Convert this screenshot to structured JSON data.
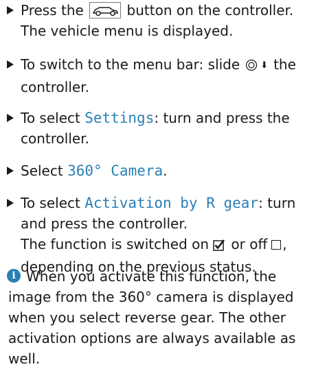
{
  "steps": [
    {
      "a": "Press the",
      "b": "button on the controller.",
      "c": "The vehicle menu is displayed.",
      "icon": "car-button-icon"
    },
    {
      "a": "To switch to the menu bar: slide",
      "b": "the",
      "c": "controller.",
      "icons": [
        "controller-icon",
        "down-arrow-icon"
      ]
    },
    {
      "a": "To select",
      "keyword": "Settings",
      "b": ": turn and press the",
      "c": "controller."
    },
    {
      "a": "Select",
      "keyword": "360° Camera",
      "b": "."
    },
    {
      "a": "To select",
      "keyword": "Activation by R gear",
      "b": ": turn",
      "c": "and press the controller.",
      "d": "The function is switched on",
      "e": "or off",
      "f": ",",
      "g": "depending on the previous status.",
      "icons": [
        "checked-box-icon",
        "unchecked-box-icon"
      ]
    }
  ],
  "info": {
    "icon_letter": "i",
    "line1": "When you activate this function, the",
    "rest": "image from the 360° camera is displayed when you select reverse gear. The other activation options are always available as well."
  },
  "colors": {
    "keyword": "#2a7fb4",
    "text": "#1a1a1a",
    "info_icon": "#2a7fb4"
  }
}
